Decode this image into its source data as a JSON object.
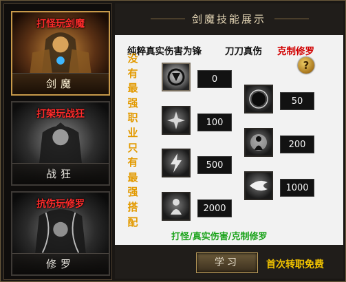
{
  "colors": {
    "accent_gold": "#c89a4a",
    "caption_red": "#ff2b2b",
    "vertical_orange": "#e39a00",
    "tags_green": "#1aa31a",
    "free_yellow": "#f0c200"
  },
  "classes": [
    {
      "caption": "打怪玩剑魔",
      "name": "剑魔",
      "active": true
    },
    {
      "caption": "打架玩战狂",
      "name": "战狂",
      "active": false
    },
    {
      "caption": "抗伤玩修罗",
      "name": "修罗",
      "active": false
    }
  ],
  "panel": {
    "title": "剑魔技能展示",
    "headers": [
      "纯粹真实伤害为锋",
      "刀刀真伤",
      "克制修罗"
    ],
    "vertical_text": [
      "没",
      "有",
      "最",
      "强",
      "职",
      "业",
      "只",
      "有",
      "最",
      "强",
      "搭",
      "配"
    ],
    "help_label": "?",
    "skills": [
      {
        "icon": "helm-emblem-icon",
        "value": "0",
        "selected": true
      },
      {
        "icon": "burst-strike-icon",
        "value": "100"
      },
      {
        "icon": "lightning-icon",
        "value": "500"
      },
      {
        "icon": "shadow-warrior-icon",
        "value": "2000"
      },
      {
        "icon": "dark-orb-icon",
        "value": "50"
      },
      {
        "icon": "aura-figure-icon",
        "value": "200"
      },
      {
        "icon": "wave-blast-icon",
        "value": "1000"
      }
    ],
    "tags": "打怪/真实伤害/克制修罗"
  },
  "footer": {
    "learn_label": "学习",
    "free_label": "首次转职免费"
  }
}
